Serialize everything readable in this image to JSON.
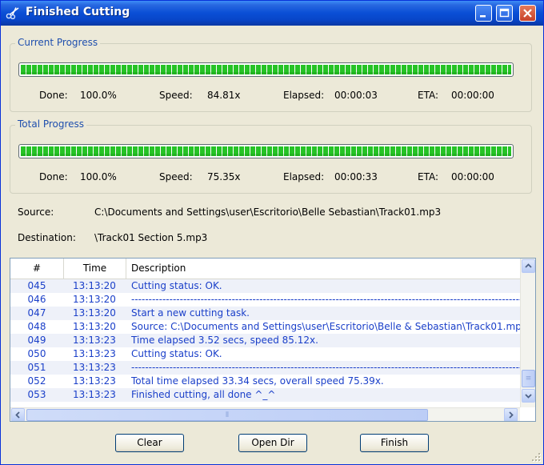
{
  "window": {
    "title": "Finished Cutting"
  },
  "current_progress": {
    "label": "Current Progress",
    "percent": 100.0,
    "done_label": "Done:",
    "done_value": "100.0%",
    "speed_label": "Speed:",
    "speed_value": "84.81x",
    "elapsed_label": "Elapsed:",
    "elapsed_value": "00:00:03",
    "eta_label": "ETA:",
    "eta_value": "00:00:00"
  },
  "total_progress": {
    "label": "Total Progress",
    "percent": 100.0,
    "done_label": "Done:",
    "done_value": "100.0%",
    "speed_label": "Speed:",
    "speed_value": "75.35x",
    "elapsed_label": "Elapsed:",
    "elapsed_value": "00:00:33",
    "eta_label": "ETA:",
    "eta_value": "00:00:00"
  },
  "source": {
    "label": "Source:",
    "value": "C:\\Documents and Settings\\user\\Escritorio\\Belle  Sebastian\\Track01.mp3"
  },
  "destination": {
    "label": "Destination:",
    "value": "\\Track01  Section 5.mp3"
  },
  "log": {
    "columns": [
      "#",
      "Time",
      "Description"
    ],
    "rows": [
      {
        "num": "045",
        "time": "13:13:20",
        "desc": "Cutting status: OK."
      },
      {
        "num": "046",
        "time": "13:13:20",
        "desc": "--------------------------------------------------------------------------------------------------------------------"
      },
      {
        "num": "047",
        "time": "13:13:20",
        "desc": "Start a new cutting task."
      },
      {
        "num": "048",
        "time": "13:13:20",
        "desc": "Source:  C:\\Documents and Settings\\user\\Escritorio\\Belle & Sebastian\\Track01.mp3"
      },
      {
        "num": "049",
        "time": "13:13:23",
        "desc": "Time elapsed 3.52 secs, speed 85.12x."
      },
      {
        "num": "050",
        "time": "13:13:23",
        "desc": "Cutting status: OK."
      },
      {
        "num": "051",
        "time": "13:13:23",
        "desc": "--------------------------------------------------------------------------------------------------------------------"
      },
      {
        "num": "052",
        "time": "13:13:23",
        "desc": "Total time elapsed 33.34 secs, overall speed 75.39x."
      },
      {
        "num": "053",
        "time": "13:13:23",
        "desc": "Finished cutting, all done ^_^"
      }
    ]
  },
  "buttons": {
    "clear": "Clear",
    "open_dir": "Open Dir",
    "finish": "Finish"
  },
  "colors": {
    "title_bar": "#0a4fd6",
    "progress_fill": "#26c326",
    "log_text": "#1a3fc9",
    "group_label": "#1f4fae"
  }
}
